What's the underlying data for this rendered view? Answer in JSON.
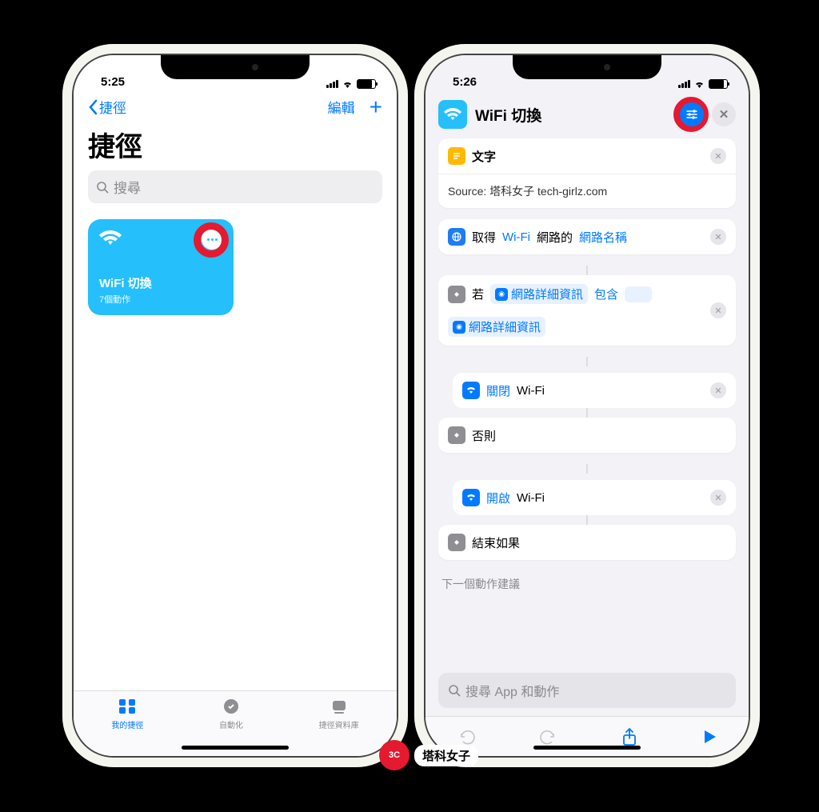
{
  "left": {
    "status_time": "5:25",
    "nav_back": "捷徑",
    "nav_edit": "編輯",
    "title": "捷徑",
    "search_placeholder": "搜尋",
    "tile": {
      "title": "WiFi 切換",
      "subtitle": "7個動作"
    },
    "tabs": {
      "my": "我的捷徑",
      "auto": "自動化",
      "gallery": "捷徑資料庫"
    }
  },
  "right": {
    "status_time": "5:26",
    "title": "WiFi 切換",
    "text_action": {
      "label": "文字",
      "content": "Source: 塔科女子 tech-girlz.com"
    },
    "get_network": {
      "pre": "取得",
      "t1": "Wi-Fi",
      "mid": "網路的",
      "t2": "網路名稱"
    },
    "if_action": {
      "pre": "若",
      "chip1": "網路詳細資訊",
      "mid": "包含",
      "line2": "網路詳細資訊"
    },
    "wifi_off": {
      "pre": "關閉",
      "t": "Wi-Fi"
    },
    "else_label": "否則",
    "wifi_on": {
      "pre": "開啟",
      "t": "Wi-Fi"
    },
    "endif": "結束如果",
    "next_suggestion": "下一個動作建議",
    "search_apps": "搜尋 App 和動作"
  },
  "watermark": "塔科女子"
}
